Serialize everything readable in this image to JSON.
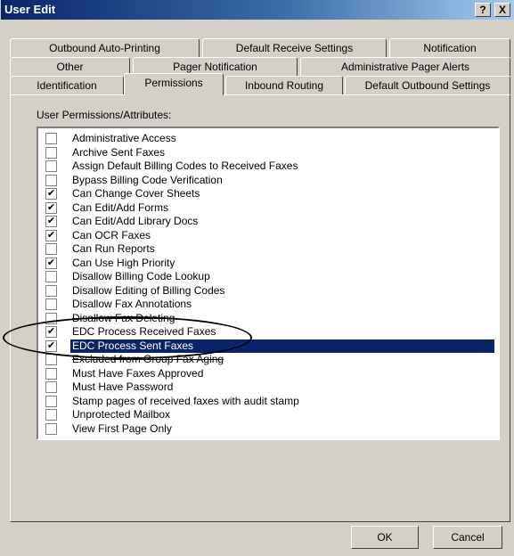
{
  "window": {
    "title": "User Edit",
    "help_button": "?",
    "close_button": "X"
  },
  "tabs": {
    "row1": [
      "Outbound Auto-Printing",
      "Default Receive Settings",
      "Notification"
    ],
    "row2": [
      "Other",
      "Pager Notification",
      "Administrative Pager Alerts"
    ],
    "row3": [
      "Identification",
      "Permissions",
      "Inbound Routing",
      "Default Outbound Settings"
    ],
    "active": "Permissions"
  },
  "permissions": {
    "group_label": "User Permissions/Attributes:",
    "items": [
      {
        "label": "Administrative Access",
        "checked": false
      },
      {
        "label": "Archive Sent Faxes",
        "checked": false
      },
      {
        "label": "Assign Default Billing Codes to Received Faxes",
        "checked": false
      },
      {
        "label": "Bypass Billing Code Verification",
        "checked": false
      },
      {
        "label": "Can Change Cover Sheets",
        "checked": true
      },
      {
        "label": "Can Edit/Add Forms",
        "checked": true
      },
      {
        "label": "Can Edit/Add Library Docs",
        "checked": true
      },
      {
        "label": "Can OCR Faxes",
        "checked": true
      },
      {
        "label": "Can Run Reports",
        "checked": false
      },
      {
        "label": "Can Use High Priority",
        "checked": true
      },
      {
        "label": "Disallow Billing Code Lookup",
        "checked": false
      },
      {
        "label": "Disallow Editing of Billing Codes",
        "checked": false
      },
      {
        "label": "Disallow Fax Annotations",
        "checked": false
      },
      {
        "label": "Disallow Fax Deleting",
        "checked": false
      },
      {
        "label": "EDC Process Received Faxes",
        "checked": true
      },
      {
        "label": "EDC Process Sent Faxes",
        "checked": true,
        "selected": true
      },
      {
        "label": "Excluded from Group Fax Aging",
        "checked": false
      },
      {
        "label": "Must Have Faxes Approved",
        "checked": false
      },
      {
        "label": "Must Have Password",
        "checked": false
      },
      {
        "label": "Stamp pages of received faxes with audit stamp",
        "checked": false
      },
      {
        "label": "Unprotected Mailbox",
        "checked": false
      },
      {
        "label": "View First Page Only",
        "checked": false
      }
    ]
  },
  "buttons": {
    "ok": "OK",
    "cancel": "Cancel"
  }
}
